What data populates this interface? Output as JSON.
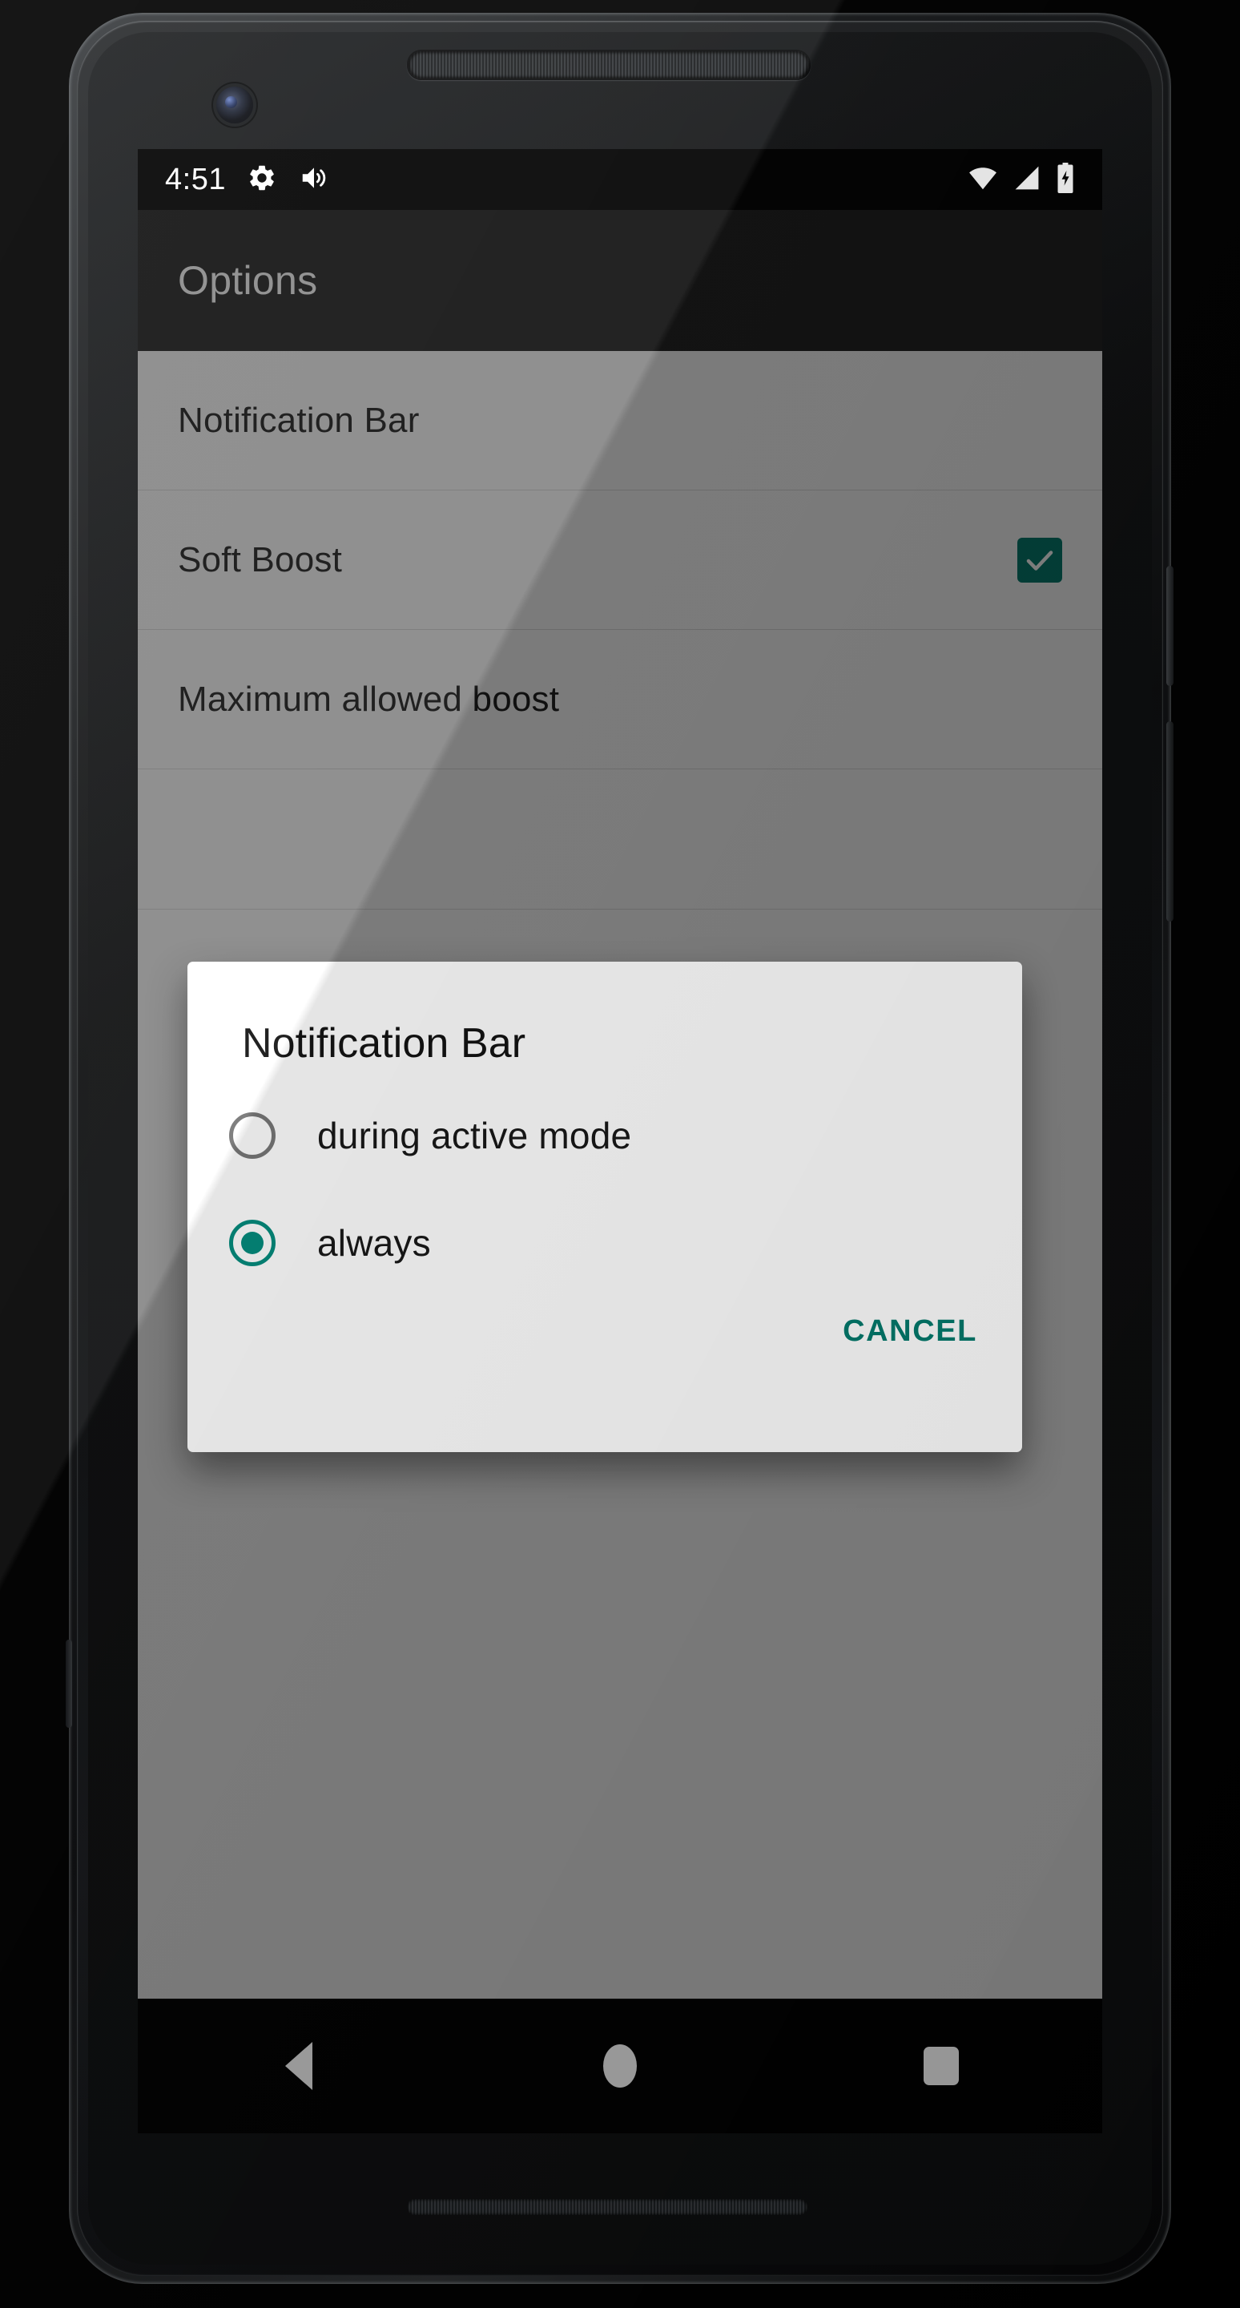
{
  "status_bar": {
    "time": "4:51",
    "left_icons": [
      "gear-icon",
      "volume-up-icon"
    ],
    "right_icons": [
      "wifi-icon",
      "cellular-signal-icon",
      "battery-charging-icon"
    ]
  },
  "app_bar": {
    "title": "Options"
  },
  "settings_list": {
    "rows": [
      {
        "label": "Notification Bar",
        "control": "none"
      },
      {
        "label": "Soft Boost",
        "control": "checkbox",
        "checked": true
      },
      {
        "label": "Maximum allowed boost",
        "control": "none"
      },
      {
        "label": "",
        "control": "none"
      }
    ]
  },
  "dialog": {
    "title": "Notification Bar",
    "options": [
      {
        "label": "during active mode",
        "selected": false
      },
      {
        "label": "always",
        "selected": true
      }
    ],
    "cancel_label": "CANCEL"
  },
  "navigation_bar": {
    "buttons": [
      "back-button",
      "home-button",
      "recents-button"
    ]
  },
  "colors": {
    "accent_teal": "#00796B",
    "radio_teal": "#00897B",
    "app_bar": "#212121",
    "list_bg": "#FAFAFA",
    "scrim": "rgba(0,0,0,0.46)"
  }
}
